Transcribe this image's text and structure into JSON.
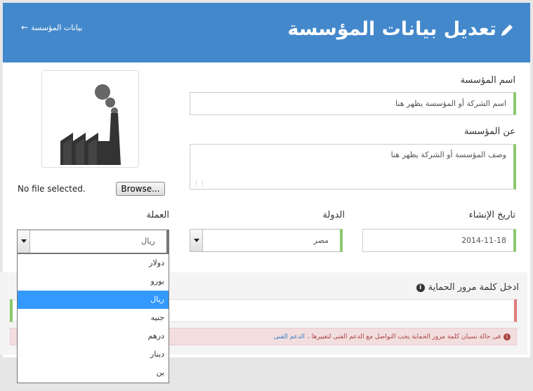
{
  "header": {
    "title": "تعديل بيانات المؤسسة",
    "back_link": "بيانات المؤسسة",
    "bg_color": "#4488cc"
  },
  "form": {
    "name_label": "اسم المؤسسة",
    "name_value": "اسم الشركة أو المؤسسة يظهر هنا",
    "about_label": "عن المؤسسة",
    "about_value": "وصف المؤسسة أو الشركة يظهر هنا",
    "logo": {
      "browse_label": "Browse...",
      "file_status": "No file selected."
    },
    "date_label": "تاريخ الإنشاء",
    "date_value": "2014-11-18",
    "country_label": "الدولة",
    "country_value": "مصر",
    "currency_label": "العملة",
    "currency_value": "ريال"
  },
  "currency_dropdown": {
    "options": [
      "دولار",
      "يورو",
      "ريال",
      "جنيه",
      "درهم",
      "دينار",
      "ين"
    ],
    "selected_index": 2
  },
  "protection": {
    "label": "ادخل كلمة مرور الحماية",
    "alert_text": "فى حالة نسيان كلمة مرور الحماية يجب التواصل مع الدعم الفنى لتغييرها ،",
    "alert_link": "الدعم الفنى"
  },
  "colors": {
    "accent": "#4488cc",
    "valid": "#8cc86e",
    "error": "#e07a7a",
    "dropdown_highlight": "#3399ff"
  }
}
